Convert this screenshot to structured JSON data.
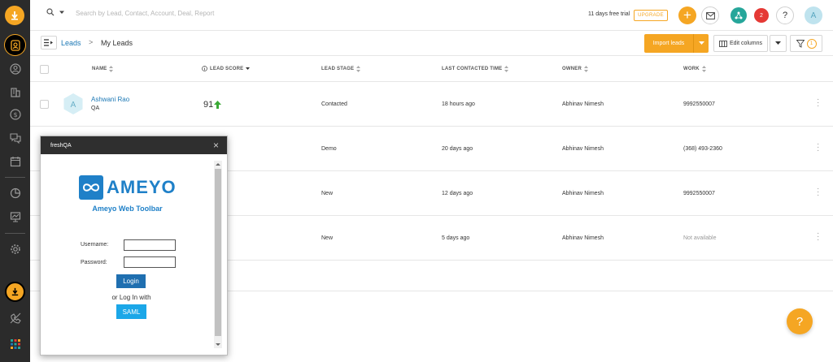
{
  "search": {
    "placeholder": "Search by Lead, Contact, Account, Deal, Report"
  },
  "topbar": {
    "trial_text": "11 days free trial",
    "upgrade_label": "UPGRADE",
    "add_label": "+",
    "notification_count": "2",
    "help_label": "?",
    "avatar_initial": "A"
  },
  "breadcrumb": {
    "root": "Leads",
    "separator": ">",
    "current": "My Leads"
  },
  "toolbar": {
    "import_label": "Import leads",
    "edit_columns_label": "Edit columns",
    "filter_count": "1"
  },
  "table": {
    "headers": [
      "NAME",
      "LEAD SCORE",
      "LEAD STAGE",
      "LAST CONTACTED TIME",
      "OWNER",
      "WORK"
    ],
    "rows": [
      {
        "avatar": "A",
        "name": "Ashwani Rao",
        "title": "QA",
        "score": "91",
        "stage": "Contacted",
        "last_contacted": "18 hours ago",
        "owner": "Abhinav Nimesh",
        "work": "9992550007"
      },
      {
        "stage": "Demo",
        "last_contacted": "20 days ago",
        "owner": "Abhinav Nimesh",
        "work": "(368) 493-2360"
      },
      {
        "stage": "New",
        "last_contacted": "12 days ago",
        "owner": "Abhinav Nimesh",
        "work": "9992550007"
      },
      {
        "stage": "New",
        "last_contacted": "5 days ago",
        "owner": "Abhinav Nimesh",
        "work": "Not available"
      }
    ]
  },
  "popup": {
    "title": "freshQA",
    "close": "×",
    "logo_text": "AMEYO",
    "toolbar_title": "Ameyo Web Toolbar",
    "username_label": "Username:",
    "password_label": "Password:",
    "login_label": "Login",
    "or_text": "or Log In with",
    "saml_label": "SAML"
  },
  "help_fab": "?",
  "colors": {
    "accent": "#f5a623",
    "link": "#1c78b5",
    "sidebar": "#2b2b2b",
    "ameyo_blue": "#1f80c8",
    "score_up": "#3aa935"
  }
}
